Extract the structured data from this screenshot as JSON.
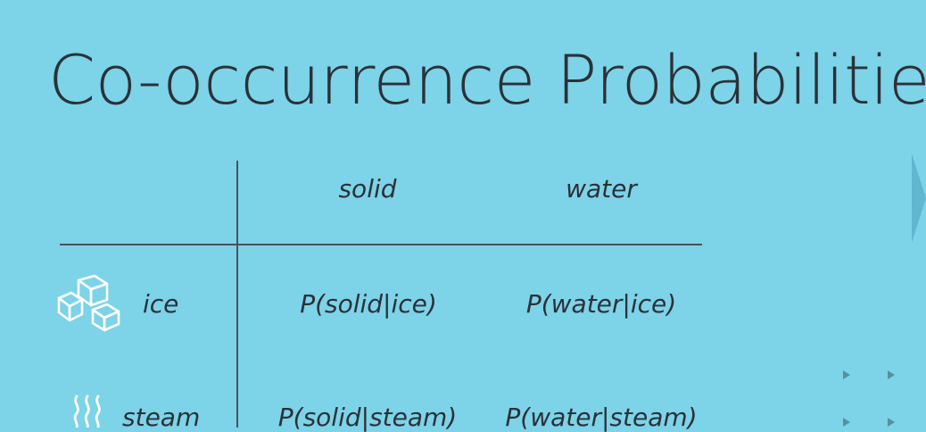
{
  "slide": {
    "title": "Co-occurrence Probabilities"
  },
  "table": {
    "columns": [
      "solid",
      "water"
    ],
    "rows": [
      {
        "label": "ice",
        "icon": "ice-cubes-icon",
        "cells": [
          "P(solid|ice)",
          "P(water|ice)"
        ]
      },
      {
        "label": "steam",
        "icon": "steam-icon",
        "cells": [
          "P(solid|steam)",
          "P(water|steam)"
        ]
      }
    ]
  },
  "colors": {
    "background": "#7dd3e8",
    "text": "#2b3138",
    "lines": "#4a5259",
    "icon": "#ffffff"
  }
}
